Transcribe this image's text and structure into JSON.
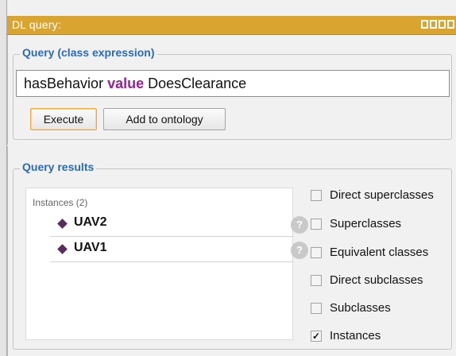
{
  "window": {
    "title": "DL query:"
  },
  "query": {
    "legend": "Query (class expression)",
    "expression": {
      "part1": "hasBehavior ",
      "keyword": "value",
      "part2": " DoesClearance"
    },
    "buttons": {
      "execute": "Execute",
      "add_to_ontology": "Add to ontology"
    }
  },
  "results": {
    "legend": "Query results",
    "header": "Instances (2)",
    "items": [
      {
        "name": "UAV2",
        "help": "?"
      },
      {
        "name": "UAV1",
        "help": "?"
      }
    ]
  },
  "options": [
    {
      "label": "Direct superclasses",
      "checked": false
    },
    {
      "label": "Superclasses",
      "checked": false
    },
    {
      "label": "Equivalent classes",
      "checked": false
    },
    {
      "label": "Direct subclasses",
      "checked": false
    },
    {
      "label": "Subclasses",
      "checked": false
    },
    {
      "label": "Instances",
      "checked": true
    }
  ],
  "colors": {
    "title_bar": "#d9a430",
    "legend_text": "#2a6ab8",
    "keyword": "#9b1d9b",
    "individual_diamond": "#5b2a60"
  }
}
